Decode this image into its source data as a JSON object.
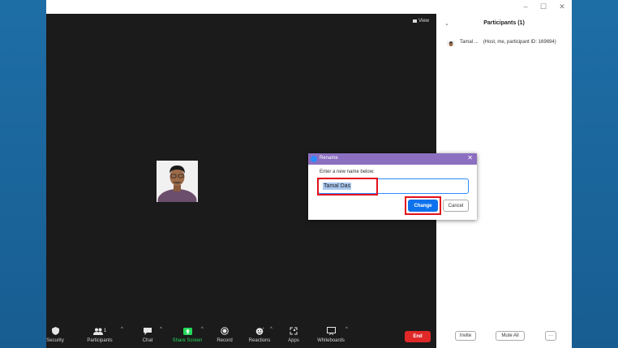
{
  "window": {
    "minimize": "–",
    "maximize": "☐",
    "close": "✕"
  },
  "video": {
    "view_label": "View"
  },
  "toolbar": {
    "security": "Security",
    "participants": "Participants",
    "participants_count": "1",
    "chat": "Chat",
    "share_screen": "Share Screen",
    "record": "Record",
    "reactions": "Reactions",
    "apps": "Apps",
    "whiteboards": "Whiteboards",
    "end": "End",
    "share_color": "#23d959",
    "end_color": "#e02828"
  },
  "participants_panel": {
    "title": "Participants (1)",
    "participant": {
      "name": "Tamal ...",
      "detail": "(Host, me, participant ID: 169694)"
    },
    "invite": "Invite",
    "mute_all": "Mute All",
    "more": "···"
  },
  "rename_dialog": {
    "title": "Rename",
    "close": "✕",
    "prompt": "Enter a new name below:",
    "input_value": "Tamal Das",
    "change": "Change",
    "cancel": "Cancel",
    "header_color": "#8c6fc1",
    "highlight_color": "#e3101b"
  }
}
